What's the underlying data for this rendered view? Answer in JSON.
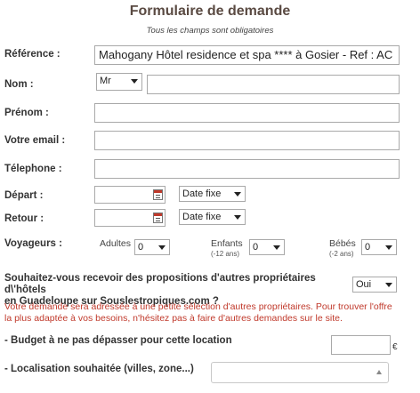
{
  "form": {
    "title": "Formulaire de demande",
    "required_note": "Tous les champs sont obligatoires",
    "reference_label": "Référence :",
    "reference_value": "Mahogany Hôtel residence et spa **** à Gosier - Ref : AC",
    "nom_label": "Nom :",
    "civility_value": "Mr",
    "prenom_label": "Prénom :",
    "email_label": "Votre email :",
    "telephone_label": "Télephone :",
    "depart_label": "Départ :",
    "depart_mode": "Date fixe",
    "retour_label": "Retour :",
    "retour_mode": "Date fixe",
    "voyageurs_label": "Voyageurs :",
    "adultes_label": "Adultes",
    "adultes_value": "0",
    "enfants_label": "Enfants",
    "enfants_sub": "(-12 ans)",
    "enfants_value": "0",
    "bebes_label": "Bébés",
    "bebes_sub": "(-2 ans)",
    "bebes_value": "0",
    "proposals_question_line1": "Souhaitez-vous recevoir des propositions d'autres propriétaires d\\'hôtels",
    "proposals_question_line2": "en Guadeloupe sur Souslestropiques.com ?",
    "proposals_value": "Oui",
    "notice_line1": "Votre demande sera adressée à une petite sélection d'autres propriétaires. Pour trouver l'offre",
    "notice_line2": "la plus adaptée à vos besoins, n'hésitez pas à faire d'autres demandes sur le site.",
    "budget_label": "- Budget à ne pas dépasser pour cette location",
    "budget_currency": "€",
    "localisation_label": "- Localisation souhaitée (villes, zone...)"
  }
}
